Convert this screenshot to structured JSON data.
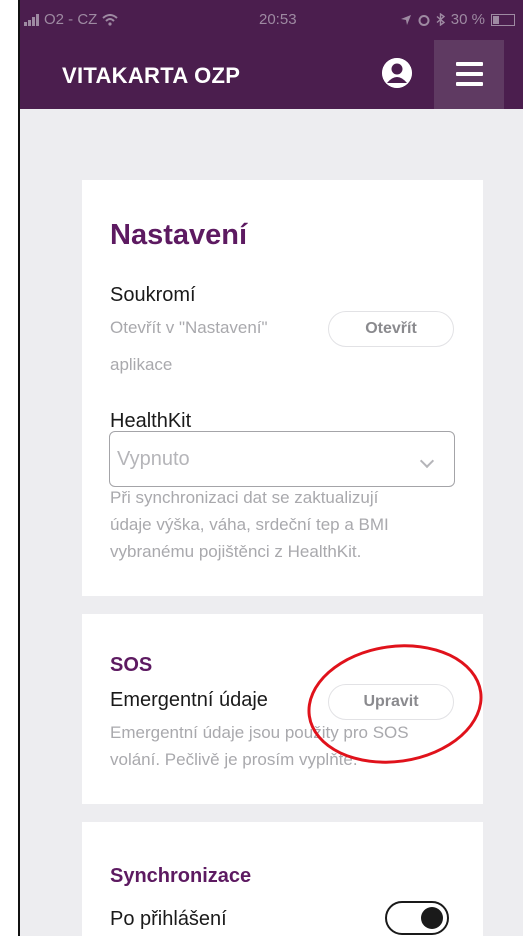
{
  "status_bar": {
    "carrier": "O2 - CZ",
    "time": "20:53",
    "battery": "30 %"
  },
  "header": {
    "title": "VITAKARTA OZP"
  },
  "settings": {
    "title": "Nastavení",
    "privacy": {
      "label": "Soukromí",
      "hint_line1": "Otevřít v \"Nastavení\"",
      "hint_line2": "aplikace",
      "button": "Otevřít"
    },
    "healthkit": {
      "label": "HealthKit",
      "selected": "Vypnuto",
      "desc_line1": "Při synchronizaci dat se zaktualizují",
      "desc_line2": "údaje výška, váha, srdeční tep a BMI",
      "desc_line3": "vybranému pojištěnci z HealthKit."
    }
  },
  "sos": {
    "title": "SOS",
    "label": "Emergentní údaje",
    "button": "Upravit",
    "desc_line1": "Emergentní údaje jsou použity pro SOS",
    "desc_line2": "volání. Pečlivě je prosím vyplňte."
  },
  "sync": {
    "title": "Synchronizace",
    "label": "Po přihlášení",
    "toggle_on": true
  },
  "colors": {
    "brand": "#4b1e4e",
    "heading": "#5d1a61",
    "annotation": "#e0121b"
  }
}
